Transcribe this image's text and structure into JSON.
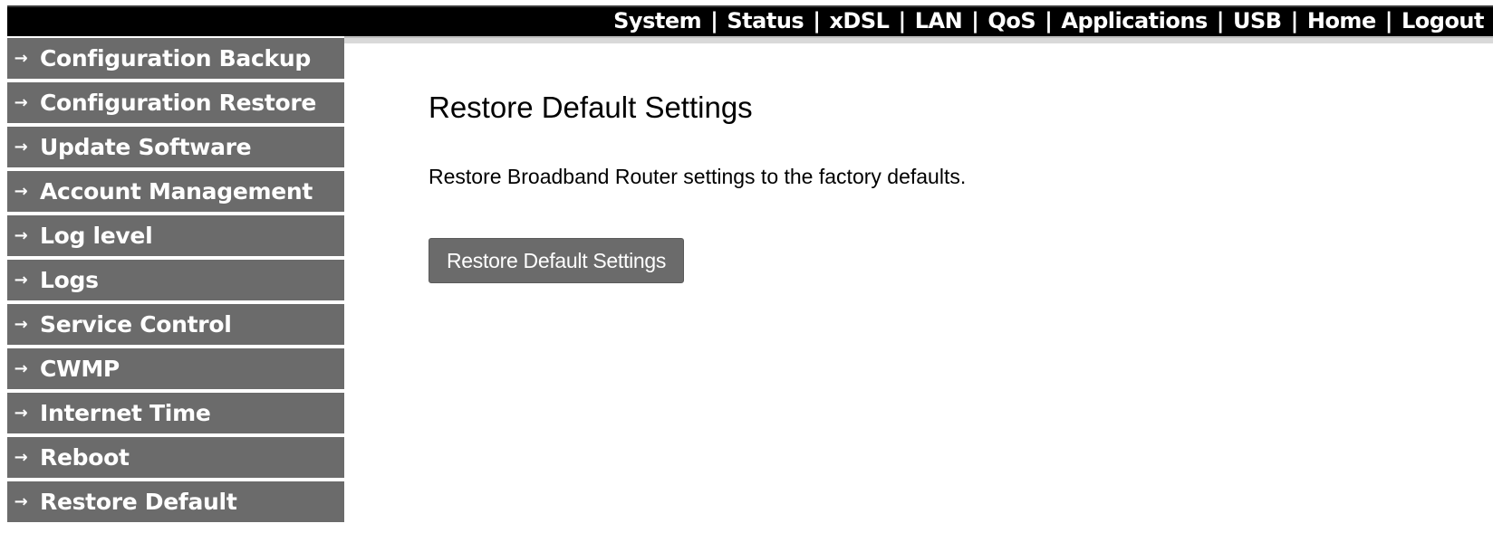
{
  "topnav": {
    "items": [
      {
        "label": "System"
      },
      {
        "label": "Status"
      },
      {
        "label": "xDSL"
      },
      {
        "label": "LAN"
      },
      {
        "label": "QoS"
      },
      {
        "label": "Applications"
      },
      {
        "label": "USB"
      },
      {
        "label": "Home"
      },
      {
        "label": "Logout"
      }
    ],
    "separator": "|"
  },
  "sidebar": {
    "arrow": "→",
    "items": [
      {
        "label": "Configuration Backup"
      },
      {
        "label": "Configuration Restore"
      },
      {
        "label": "Update Software"
      },
      {
        "label": "Account Management"
      },
      {
        "label": "Log level"
      },
      {
        "label": "Logs"
      },
      {
        "label": "Service Control"
      },
      {
        "label": "CWMP"
      },
      {
        "label": "Internet Time"
      },
      {
        "label": "Reboot"
      },
      {
        "label": "Restore Default"
      }
    ]
  },
  "main": {
    "title": "Restore Default Settings",
    "description": "Restore Broadband Router settings to the factory defaults.",
    "button_label": "Restore Default Settings"
  },
  "colors": {
    "topbar": "#000000",
    "sidebar_item": "#6b6b6b",
    "button": "#6b6b6b",
    "text_light": "#ffffff"
  }
}
